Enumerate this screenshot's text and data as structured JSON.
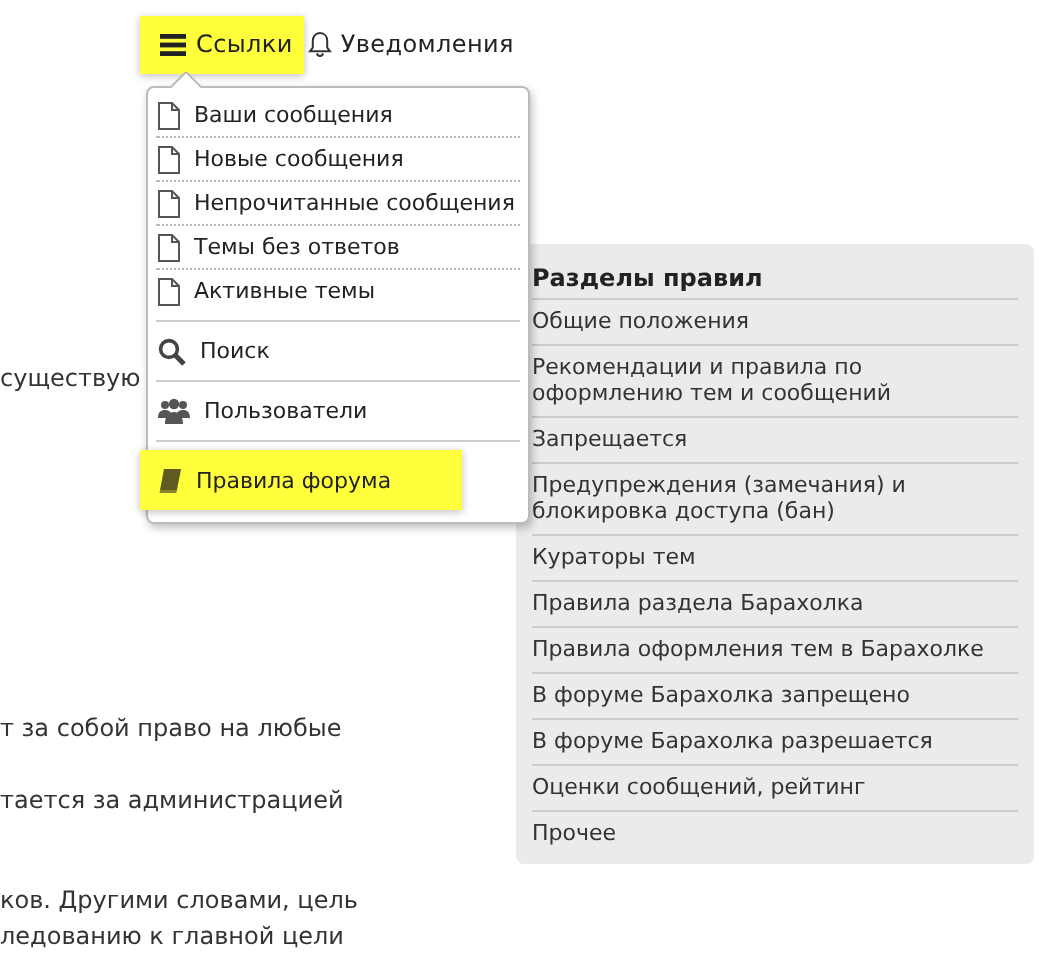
{
  "nav": [
    {
      "label": "Ссылки",
      "kind": "menu",
      "selected": true
    },
    {
      "label": "Уведомления",
      "kind": "bell",
      "selected": false
    }
  ],
  "dropdown": {
    "items": [
      {
        "label": "Ваши сообщения",
        "kind": "page",
        "selected": false
      },
      {
        "label": "Новые сообщения",
        "kind": "page",
        "selected": false
      },
      {
        "label": "Непрочитанные сообщения",
        "kind": "page",
        "selected": false
      },
      {
        "label": "Темы без ответов",
        "kind": "page",
        "selected": false
      },
      {
        "label": "Активные темы",
        "kind": "page",
        "selected": false
      },
      {
        "label": "Поиск",
        "kind": "search",
        "selected": false
      },
      {
        "label": "Пользователи",
        "kind": "users",
        "selected": false
      },
      {
        "label": "Правила форума",
        "kind": "book",
        "selected": true
      }
    ]
  },
  "body_text": [
    [
      "существую"
    ],
    [
      "т за собой право на любые"
    ],
    [
      "тается за администрацией"
    ],
    [
      "ков. Другими словами, цель",
      "ледованию к главной цели"
    ]
  ],
  "sidebar": {
    "title": "Разделы правил",
    "items": [
      "Общие положения",
      "Рекомендации и правила по оформлению тем и сообщений",
      "Запрещается",
      "Предупреждения (замечания) и блокировка доступа (бан)",
      "Кураторы тем",
      "Правила раздела Барахолка",
      "Правила оформления тем в Барахолке",
      "В форуме Барахолка запрещено",
      "В форуме Барахолка разрешается",
      "Оценки сообщений, рейтинг",
      "Прочее"
    ]
  }
}
